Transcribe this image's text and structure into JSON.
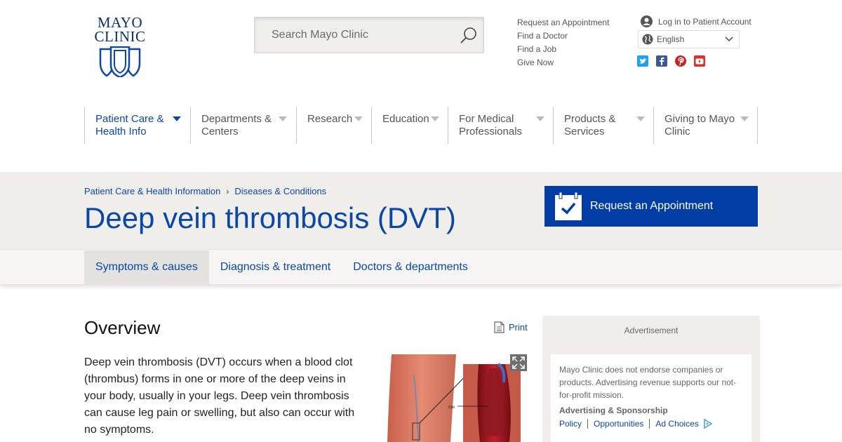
{
  "logo": {
    "line1": "MAYO",
    "line2": "CLINIC"
  },
  "search": {
    "placeholder": "Search Mayo Clinic"
  },
  "utility_links": [
    "Request an Appointment",
    "Find a Doctor",
    "Find a Job",
    "Give Now"
  ],
  "account": {
    "login_label": "Log in to Patient Account"
  },
  "language": {
    "selected": "English"
  },
  "social": [
    {
      "icon": "twitter-icon",
      "color": "#1da1f2"
    },
    {
      "icon": "facebook-icon",
      "color": "#3b5998"
    },
    {
      "icon": "pinterest-icon",
      "color": "#cb2027"
    },
    {
      "icon": "youtube-icon",
      "color": "#e52d27"
    }
  ],
  "nav": [
    {
      "line1": "Patient Care &",
      "line2": "Health Info",
      "active": true
    },
    {
      "line1": "Departments &",
      "line2": "Centers"
    },
    {
      "line1": "Research",
      "line2": ""
    },
    {
      "line1": "Education",
      "line2": ""
    },
    {
      "line1": "For Medical",
      "line2": "Professionals"
    },
    {
      "line1": "Products &",
      "line2": "Services"
    },
    {
      "line1": "Giving to Mayo",
      "line2": "Clinic"
    }
  ],
  "breadcrumb": [
    "Patient Care & Health Information",
    "Diseases & Conditions"
  ],
  "page_title": "Deep vein thrombosis (DVT)",
  "appointment_button": "Request an Appointment",
  "tabs": [
    "Symptoms & causes",
    "Diagnosis & treatment",
    "Doctors & departments"
  ],
  "overview": {
    "heading": "Overview",
    "print_label": "Print",
    "text": "Deep vein thrombosis (DVT) occurs when a blood clot (thrombus) forms in one or more of the deep veins in your body, usually in your legs. Deep vein thrombosis can cause leg pain or swelling, but also can occur with no symptoms."
  },
  "figure": {
    "label": "Clot"
  },
  "ad": {
    "label": "Advertisement",
    "note": "Mayo Clinic does not endorse companies or products. Advertising revenue supports our not-for-profit mission.",
    "heading": "Advertising & Sponsorship",
    "links": [
      "Policy",
      "Opportunities",
      "Ad Choices"
    ]
  },
  "colors": {
    "brand_blue": "#0a47a9",
    "button_blue": "#003da5",
    "band_bg": "#efeeeb"
  }
}
